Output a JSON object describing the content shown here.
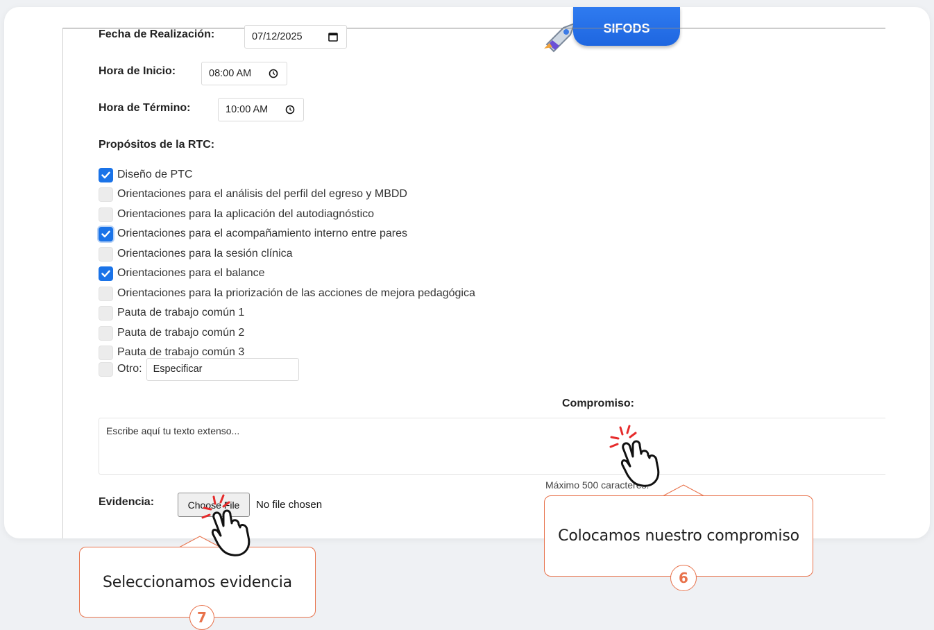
{
  "brand": {
    "name": "SIFODS",
    "color": "#1e66e0"
  },
  "form": {
    "fecha": {
      "label": "Fecha de Realización:",
      "value": "07/12/2025",
      "icon": "calendar-icon"
    },
    "inicio": {
      "label": "Hora de Inicio:",
      "value": "08:00 AM",
      "icon": "clock-icon"
    },
    "termino": {
      "label": "Hora de Término:",
      "value": "10:00 AM",
      "icon": "clock-icon"
    },
    "propositos_title": "Propósitos de la RTC:",
    "propositos": [
      {
        "label": "Diseño de PTC",
        "checked": true
      },
      {
        "label": "Orientaciones para el análisis del perfil del egreso y MBDD",
        "checked": false
      },
      {
        "label": "Orientaciones para la aplicación del autodiagnóstico",
        "checked": false
      },
      {
        "label": "Orientaciones para el acompañamiento interno entre pares",
        "checked": true
      },
      {
        "label": "Orientaciones para la sesión clínica",
        "checked": false
      },
      {
        "label": "Orientaciones para el balance",
        "checked": true
      },
      {
        "label": "Orientaciones para la priorización de las acciones de mejora pedagógica",
        "checked": false
      },
      {
        "label": "Pauta de trabajo común 1",
        "checked": false
      },
      {
        "label": "Pauta de trabajo común 2",
        "checked": false
      },
      {
        "label": "Pauta de trabajo común 3",
        "checked": false
      }
    ],
    "otro": {
      "label": "Otro:",
      "placeholder": "Especificar",
      "checked": false
    },
    "compromiso": {
      "label": "Compromiso:",
      "placeholder": "Escribe aquí tu texto extenso...",
      "hint": "Máximo 500 caracteres."
    },
    "evidencia": {
      "label": "Evidencia:",
      "button": "Choose File",
      "status": "No file chosen"
    }
  },
  "callouts": [
    {
      "text": "Colocamos nuestro compromiso",
      "step": "6"
    },
    {
      "text": "Seleccionamos evidencia",
      "step": "7"
    }
  ],
  "accent_color": "#e8724b"
}
